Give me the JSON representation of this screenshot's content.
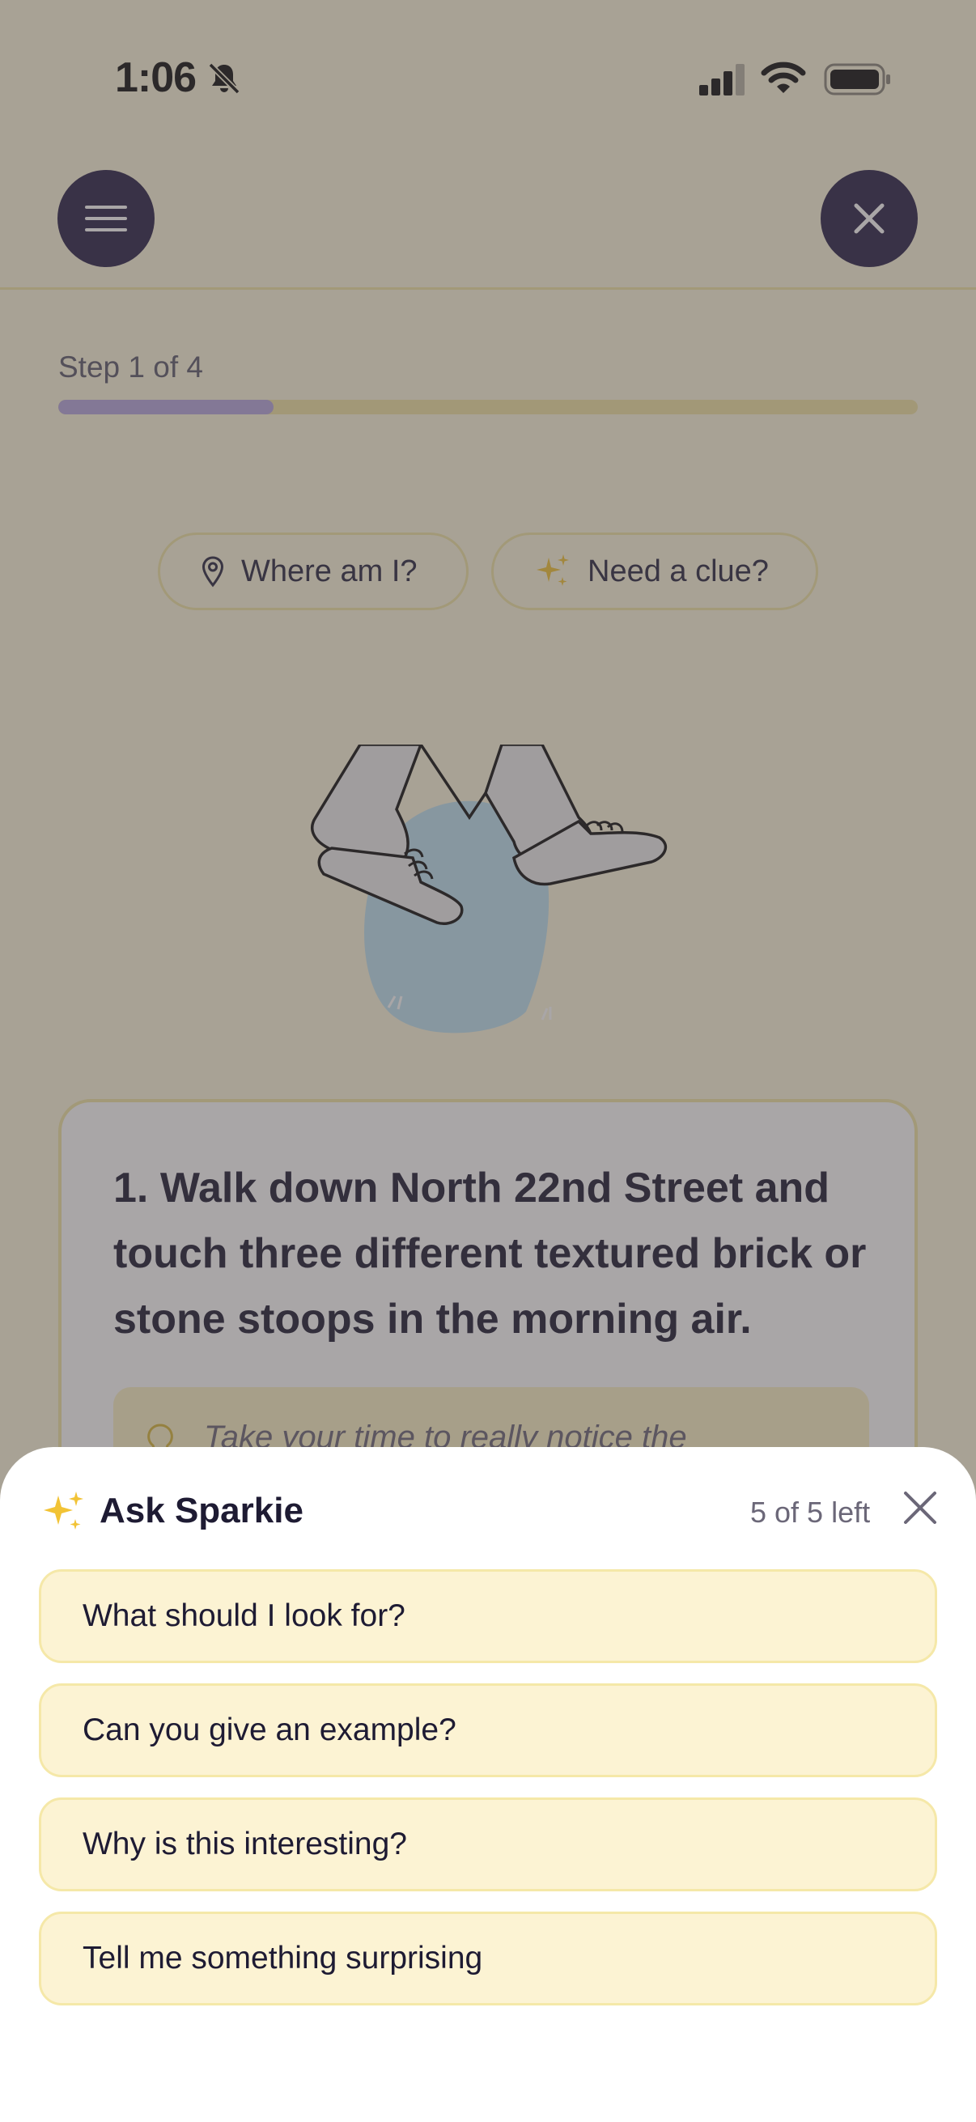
{
  "status_bar": {
    "time": "1:06"
  },
  "step": {
    "label": "Step 1 of 4",
    "progress": 0.25
  },
  "chips": {
    "where": "Where am I?",
    "clue": "Need a clue?"
  },
  "task": {
    "text": "1. Walk down North 22nd Street and touch three different textured brick or stone stoops in the morning air.",
    "hint": "Take your time to really notice the"
  },
  "sheet": {
    "title": "Ask Sparkie",
    "remaining": "5 of 5 left",
    "questions": [
      "What should I look for?",
      "Can you give an example?",
      "Why is this interesting?",
      "Tell me something surprising"
    ]
  },
  "colors": {
    "accent": "#2a2147",
    "progress": "#b7a7df",
    "chip_bg": "#fcf3d3",
    "sparkle": "#f2c335"
  }
}
